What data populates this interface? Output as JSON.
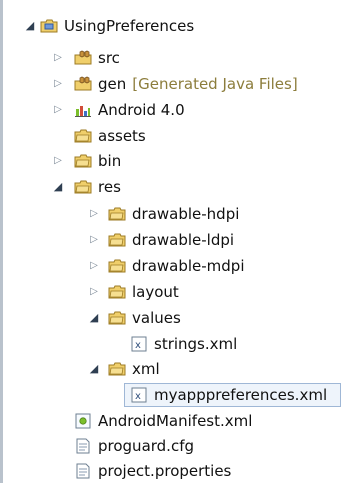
{
  "project": {
    "name": "UsingPreferences"
  },
  "tree": {
    "src_label": "src",
    "gen_label": "gen",
    "gen_note": "[Generated Java Files]",
    "android_label": "Android 4.0",
    "assets_label": "assets",
    "bin_label": "bin",
    "res_label": "res",
    "res_children": {
      "drawable_hdpi": "drawable-hdpi",
      "drawable_ldpi": "drawable-ldpi",
      "drawable_mdpi": "drawable-mdpi",
      "layout": "layout",
      "values": "values",
      "strings": "strings.xml",
      "xml": "xml",
      "myapp": "myapppreferences.xml"
    },
    "manifest_label": "AndroidManifest.xml",
    "proguard_label": "proguard.cfg",
    "project_props_label": "project.properties"
  },
  "colors": {
    "selection_fill": "#eef4fb",
    "selection_border": "#9fb7d6",
    "folder": "#f0cf6b",
    "android_green": "#7bbf2b"
  },
  "icons": {
    "project": "project-folder-icon",
    "package_folder": "source-folder-icon",
    "folder": "folder-icon",
    "library": "library-icon",
    "xml": "xml-file-icon",
    "manifest": "manifest-file-icon",
    "document": "document-file-icon"
  }
}
